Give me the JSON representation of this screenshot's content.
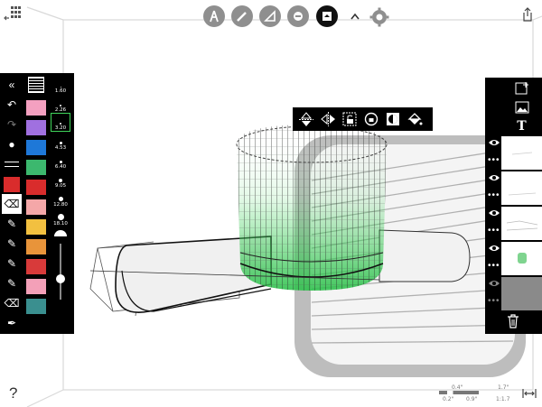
{
  "top_toolbar": {
    "tools": [
      "compass-tool",
      "pencil-tool",
      "ruler-tool",
      "eraser-tool",
      "layer-tool"
    ],
    "active_tool": "layer-tool"
  },
  "left_panel": {
    "sizes": [
      "1.60",
      "2.26",
      "3.20",
      "4.53",
      "6.40",
      "9.05",
      "12.80",
      "18.10"
    ],
    "selected_size": "3.20",
    "colors": [
      "#f4a0c0",
      "#a070e0",
      "#1e78d8",
      "#3cb86e",
      "#d92c2c",
      "#f4a7a8",
      "#f2c040",
      "#e8943a",
      "#d83a3a",
      "#f3a0b8",
      "#3a8f8f"
    ]
  },
  "right_panel": {
    "layers_count": 5,
    "selected_layer": 5
  },
  "bottom": {
    "scale_top": "0.4\"",
    "scale_left": "0.2\"",
    "scale_right": "0.9\"",
    "zoom_top": "1.7\"",
    "zoom_bottom": "1:1.7",
    "help": "?"
  },
  "colors": {
    "accent_green": "#3fd45a",
    "panel_black": "#000000",
    "button_grey": "#8f8f8f"
  }
}
